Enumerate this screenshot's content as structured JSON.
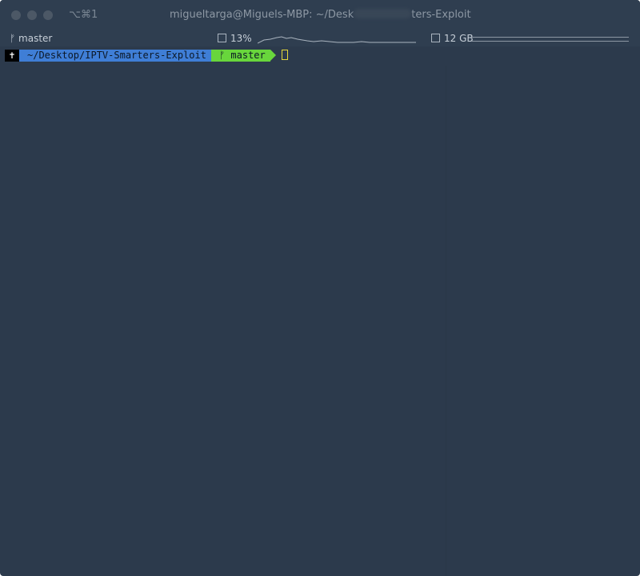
{
  "window": {
    "shortcut": "⌥⌘1",
    "title_prefix": "migueltarga@Miguels-MBP: ~/Desk",
    "title_suffix": "ters-Exploit"
  },
  "status_bar": {
    "branch": "master",
    "cpu_percent": "13%",
    "memory": "12 GB"
  },
  "prompt": {
    "root_symbol": "✝",
    "path": "~/Desktop/IPTV-Smarters-Exploit",
    "git_branch": "master"
  },
  "colors": {
    "background": "#2c3a4c",
    "path_segment": "#3f7ed6",
    "git_segment": "#68d63c",
    "cursor": "#e6d83a"
  }
}
